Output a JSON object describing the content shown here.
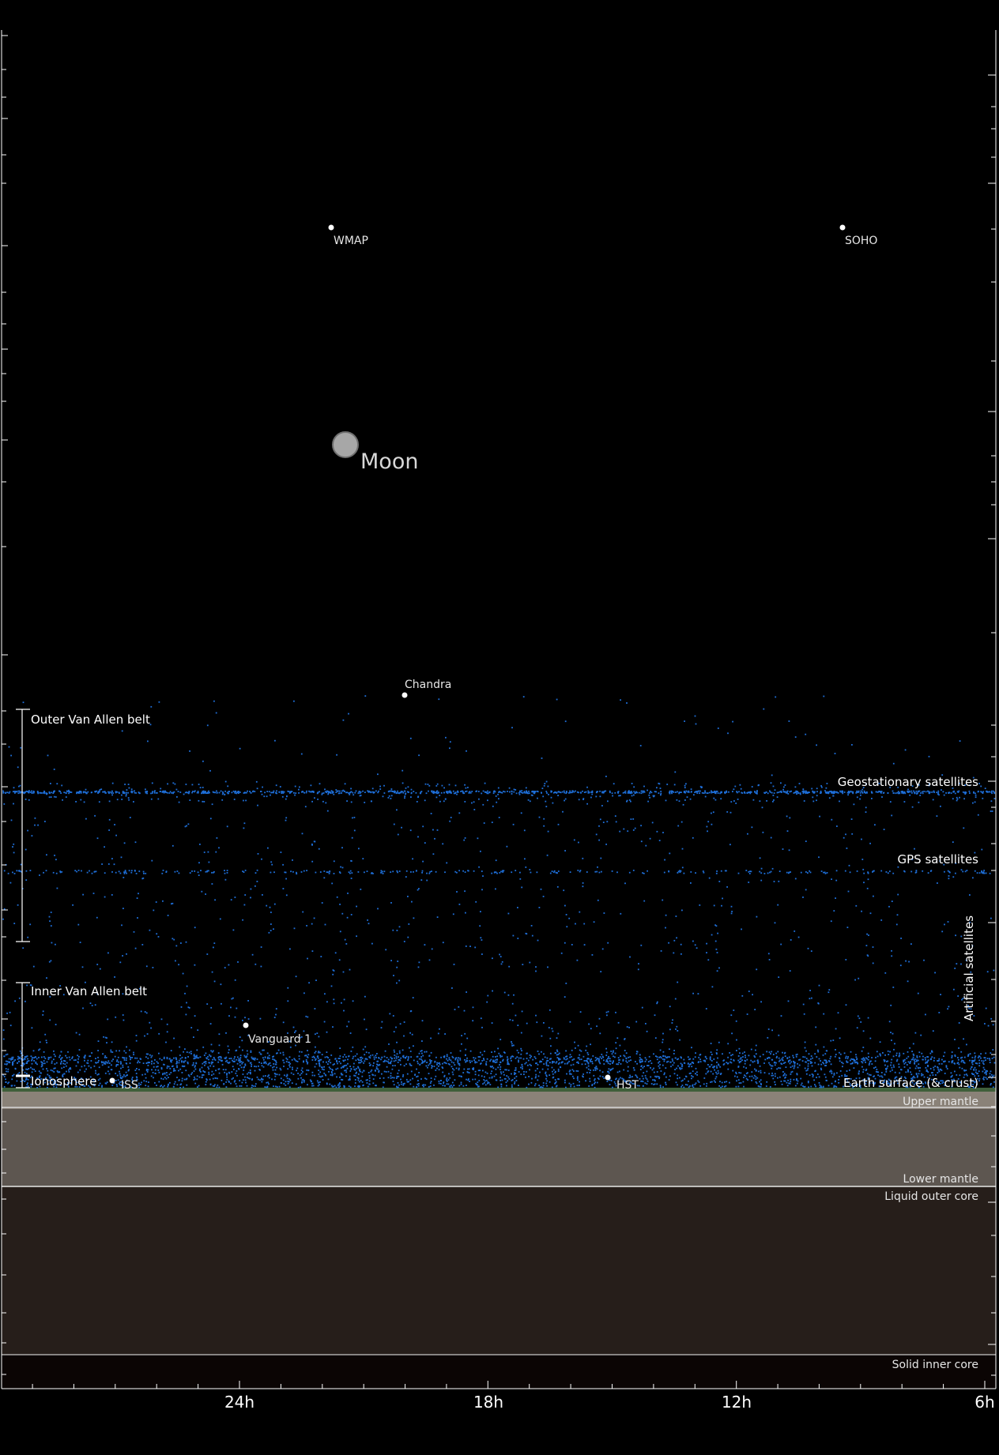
{
  "space_objects": [
    {
      "id": "wmap",
      "label": "WMAP"
    },
    {
      "id": "soho",
      "label": "SOHO"
    },
    {
      "id": "moon",
      "label": "Moon"
    },
    {
      "id": "chandra",
      "label": "Chandra"
    },
    {
      "id": "vanguard",
      "label": "Vanguard 1"
    },
    {
      "id": "iss",
      "label": "ISS"
    },
    {
      "id": "hst",
      "label": "HST"
    }
  ],
  "regions": {
    "outer_belt": "Outer Van Allen belt",
    "inner_belt": "Inner Van Allen belt",
    "ionosphere": "Ionosphere",
    "geostationary": "Geostationary satellites",
    "gps": "GPS satellites",
    "artificial": "Artificial satellites"
  },
  "layers": {
    "surface": "Earth surface (& crust)",
    "upper_mantle": "Upper mantle",
    "lower_mantle": "Lower mantle",
    "outer_core": "Liquid outer core",
    "inner_core": "Solid inner core"
  },
  "x_axis": {
    "ticks": [
      "24h",
      "18h",
      "12h",
      "6h"
    ]
  },
  "colors": {
    "background": "#000000",
    "satellite_dots": "#1e6fd9",
    "surface_line": "#3f5f3a",
    "upper_mantle": "#8a8278",
    "lower_mantle": "#5d5650",
    "outer_core": "#261e1a",
    "inner_core": "#0b0504",
    "moon": "#a7a7a7"
  }
}
